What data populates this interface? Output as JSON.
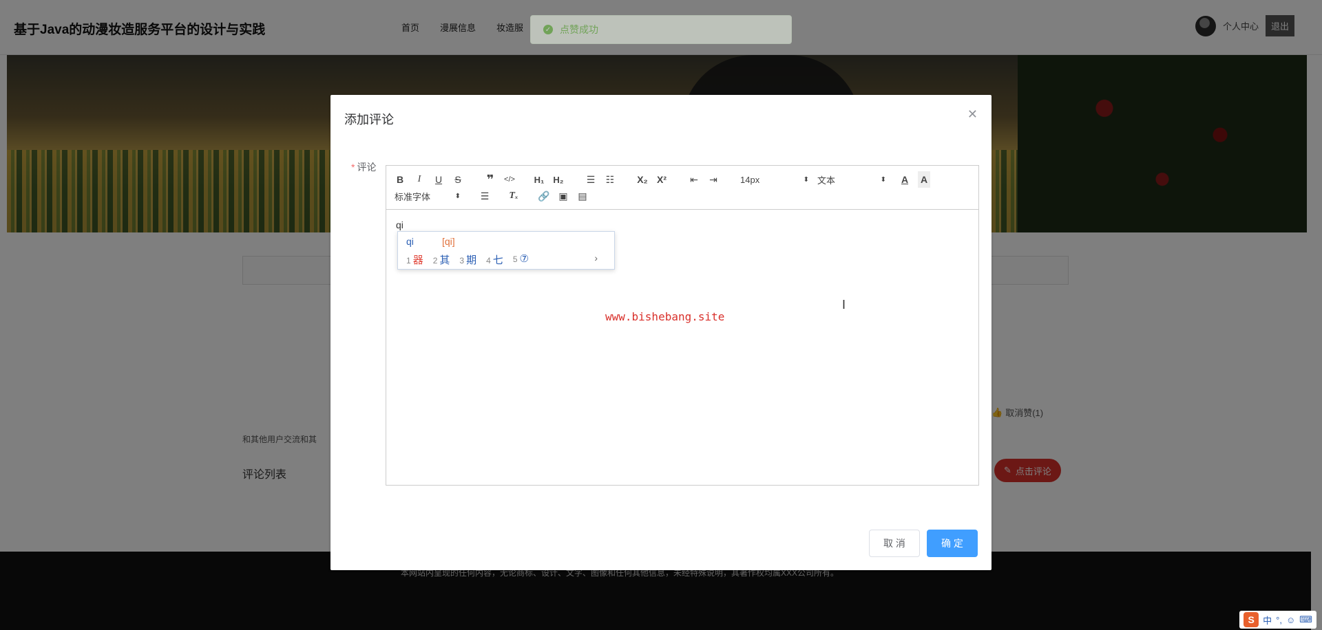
{
  "site": {
    "title": "基于Java的动漫妆造服务平台的设计与实践",
    "nav": [
      "首页",
      "漫展信息",
      "妆造服"
    ],
    "user_center": "个人中心",
    "logout": "退出"
  },
  "toast": {
    "message": "点赞成功",
    "color": "#67c23a"
  },
  "page": {
    "cancel_like": "取消赞(1)",
    "discussion_tip": "和其他用户交流和其",
    "comment_list_title": "评论列表",
    "click_comment": "点击评论",
    "footer_text": "本网站内呈现的任何内容，无论商标、设计、文字、图像和任何其他信息，未经特殊说明，其著作权均属XXX公司所有。"
  },
  "dialog": {
    "title": "添加评论",
    "close_icon": "close-icon",
    "field_label": "评论",
    "required_mark": "*",
    "editor": {
      "toolbar": {
        "font_size": "14px",
        "header_select": "文本",
        "font_family": "标准字体"
      },
      "content": "qi",
      "watermark": "www.bishebang.site"
    },
    "cancel_label": "取 消",
    "confirm_label": "确 定",
    "confirm_color": "#409eff"
  },
  "ime_popup": {
    "pinyin": "qi",
    "hint": "[qi]",
    "candidates": [
      {
        "num": "1",
        "char": "器"
      },
      {
        "num": "2",
        "char": "其"
      },
      {
        "num": "3",
        "char": "期"
      },
      {
        "num": "4",
        "char": "七"
      },
      {
        "num": "5",
        "char": "⑦"
      }
    ],
    "next": "›"
  },
  "ime_tray": {
    "logo": "S",
    "mode": "中",
    "punct": "°,",
    "emoji": "☺",
    "keyboard": "⌨"
  }
}
